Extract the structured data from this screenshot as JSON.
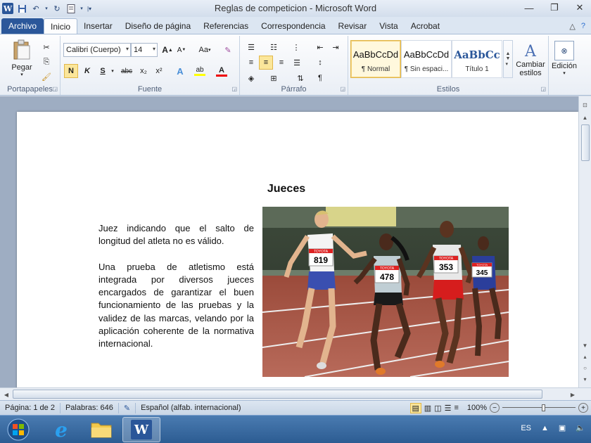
{
  "window": {
    "title": "Reglas de competicion  -  Microsoft Word",
    "controls": {
      "minimize": "—",
      "restore": "❐",
      "close": "✕"
    }
  },
  "quick_access": {
    "word_logo": "W",
    "save_icon": "save-icon",
    "undo_icon": "undo-icon",
    "redo_icon": "redo-icon"
  },
  "tabs": [
    {
      "label": "Archivo"
    },
    {
      "label": "Inicio"
    },
    {
      "label": "Insertar"
    },
    {
      "label": "Diseño de página"
    },
    {
      "label": "Referencias"
    },
    {
      "label": "Correspondencia"
    },
    {
      "label": "Revisar"
    },
    {
      "label": "Vista"
    },
    {
      "label": "Acrobat"
    }
  ],
  "ribbon": {
    "clipboard": {
      "label": "Portapapeles",
      "paste": "Pegar"
    },
    "font": {
      "label": "Fuente",
      "family": "Calibri (Cuerpo)",
      "size": "14",
      "grow": "A",
      "shrink": "A",
      "case": "Aa",
      "bold": "N",
      "italic": "K",
      "underline": "S",
      "strike": "abc",
      "subscript": "x₂",
      "superscript": "x²",
      "text_effects": "A",
      "highlight": "ab",
      "font_color": "A"
    },
    "paragraph": {
      "label": "Párrafo",
      "pilcrow": "¶"
    },
    "styles": {
      "label": "Estilos",
      "items": [
        {
          "sample": "AaBbCcDd",
          "name": "¶ Normal"
        },
        {
          "sample": "AaBbCcDd",
          "name": "¶ Sin espaci..."
        },
        {
          "sample": "AaBbCc",
          "name": "Título 1"
        }
      ],
      "change": "Cambiar estilos"
    },
    "editing": {
      "label": "Edición"
    }
  },
  "document": {
    "heading": "Jueces",
    "paragraphs": [
      "Juez indicando que el salto de longitud del atleta no es válido.",
      "Una prueba de atletismo está integrada por diversos jueces encargados de garantizar el buen funcionamiento de las pruebas y la validez de las marcas, velando por la aplicación coherente de la normativa internacional."
    ],
    "photo_bibs": [
      "TOYOTA",
      "819",
      "TOYOTA",
      "478",
      "TOYOTA",
      "353",
      "TOYOTA",
      "345"
    ]
  },
  "statusbar": {
    "page": "Página: 1 de 2",
    "words": "Palabras: 646",
    "language": "Español (alfab. internacional)",
    "zoom": "100%"
  },
  "taskbar": {
    "language": "ES"
  },
  "colors": {
    "file_tab": "#2b579a",
    "accent": "#2a5699",
    "title1_style": "#2b579a"
  }
}
